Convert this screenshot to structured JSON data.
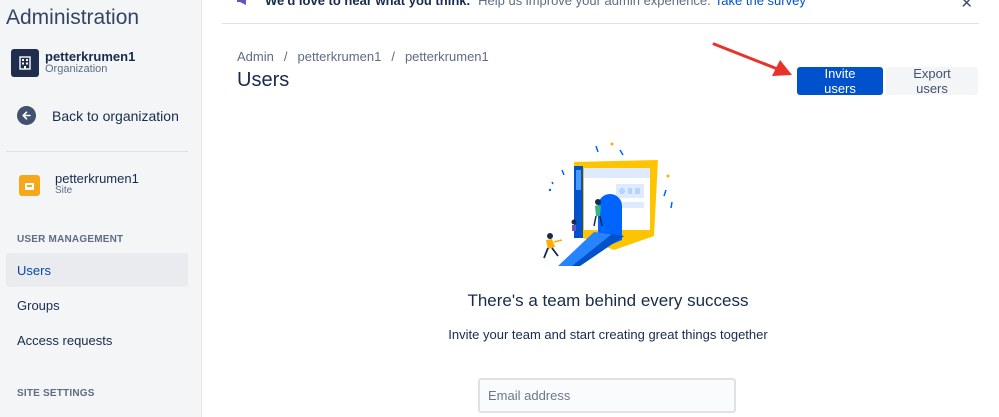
{
  "sidebar": {
    "app_title": "Administration",
    "org": {
      "name": "petterkrumen1",
      "type": "Organization"
    },
    "back_label": "Back to organization",
    "site": {
      "name": "petterkrumen1",
      "type": "Site"
    },
    "user_management_heading": "USER MANAGEMENT",
    "items": [
      {
        "label": "Users",
        "active": true
      },
      {
        "label": "Groups",
        "active": false
      },
      {
        "label": "Access requests",
        "active": false
      }
    ],
    "site_settings_heading": "SITE SETTINGS"
  },
  "banner": {
    "bold": "We'd love to hear what you think.",
    "text": "Help us improve your admin experience.",
    "link": "Take the survey"
  },
  "header": {
    "breadcrumb": [
      "Admin",
      "petterkrumen1",
      "petterkrumen1"
    ],
    "title": "Users",
    "invite_label": "Invite users",
    "export_label": "Export users"
  },
  "empty_state": {
    "heading": "There's a team behind every success",
    "description": "Invite your team and start creating great things together",
    "email_placeholder": "Email address"
  },
  "colors": {
    "primary": "#0052cc",
    "sidebar_bg": "#f4f5f7",
    "annotation_arrow": "#e8332a"
  }
}
